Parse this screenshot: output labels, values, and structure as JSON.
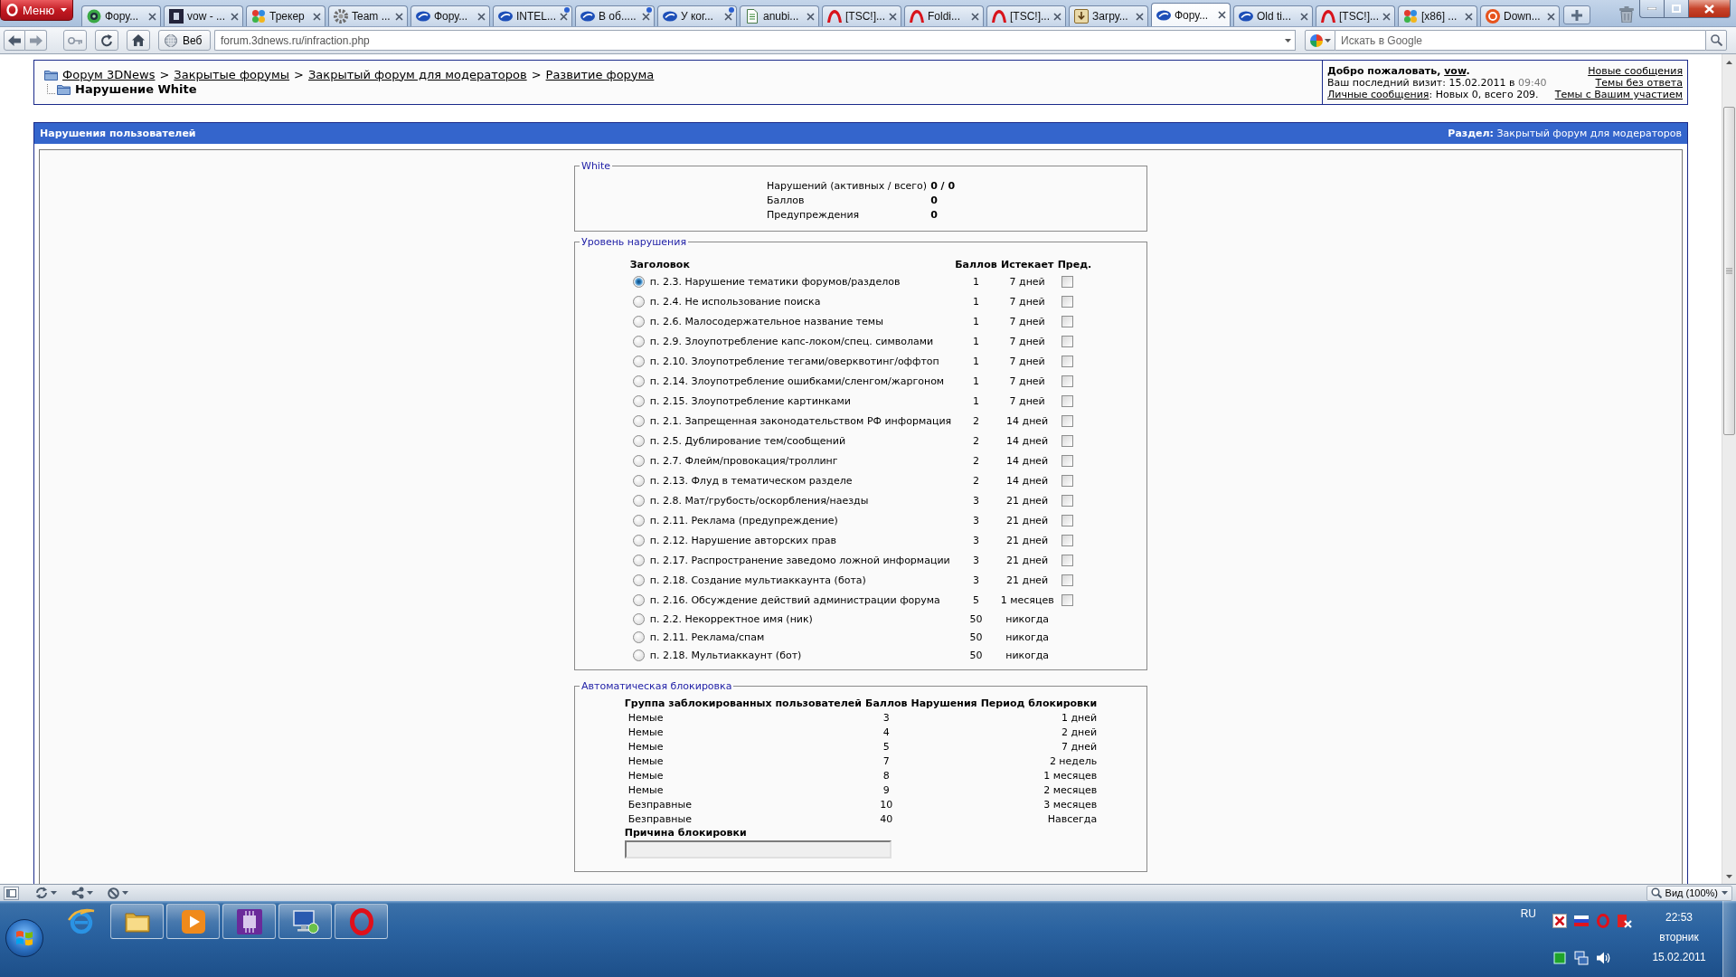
{
  "browser": {
    "menu_button": "Меню",
    "tabs": [
      {
        "title": "Фору...",
        "selected": false,
        "updated": false
      },
      {
        "title": "vow - ...",
        "selected": false,
        "updated": false
      },
      {
        "title": "Трекер",
        "selected": false,
        "updated": false
      },
      {
        "title": "Team ...",
        "selected": false,
        "updated": false
      },
      {
        "title": "Фору...",
        "selected": false,
        "updated": false
      },
      {
        "title": "INTEL...",
        "selected": false,
        "updated": true
      },
      {
        "title": "В об.....",
        "selected": false,
        "updated": true
      },
      {
        "title": "У ког...",
        "selected": false,
        "updated": true
      },
      {
        "title": "anubi...",
        "selected": false,
        "updated": false
      },
      {
        "title": "[TSC!]...",
        "selected": false,
        "updated": false
      },
      {
        "title": "Foldi...",
        "selected": false,
        "updated": false
      },
      {
        "title": "[TSC!]...",
        "selected": false,
        "updated": false
      },
      {
        "title": "Загру...",
        "selected": false,
        "updated": false
      },
      {
        "title": "Фору...",
        "selected": true,
        "updated": false
      },
      {
        "title": "Old ti...",
        "selected": false,
        "updated": false
      },
      {
        "title": "[TSC!]...",
        "selected": false,
        "updated": false
      },
      {
        "title": "[x86] ...",
        "selected": false,
        "updated": false
      },
      {
        "title": "Down...",
        "selected": false,
        "updated": false
      }
    ],
    "web_button": "Веб",
    "address": "forum.3dnews.ru/infraction.php",
    "search": {
      "placeholder": "Искать в Google"
    }
  },
  "header": {
    "breadcrumbs": [
      {
        "label": "Форум 3DNews"
      },
      {
        "separator": ">",
        "label": "Закрытые форумы"
      },
      {
        "separator": ">",
        "label": "Закрытый форум для модераторов"
      },
      {
        "separator": ">",
        "label": "Развитие форума"
      }
    ],
    "page_title": "Нарушение White",
    "welcome": {
      "greeting": "Добро пожаловать,",
      "username": "vow",
      "greeting_end": ".",
      "last_visit": "Ваш последний визит: 15.02.2011 в",
      "last_visit_time": "09:40",
      "messages_link": "Личные сообщения",
      "messages_info": ": Новых 0, всего 209."
    },
    "quick_links": [
      "Новые сообщения",
      "Темы без ответа",
      "Темы с Вашим участием"
    ]
  },
  "section_bar": {
    "title": "Нарушения пользователей",
    "forum": "**Раздел:** Закрытый форум для модераторов"
  },
  "user_summary": {
    "legend": "White",
    "rows": [
      {
        "label": "Нарушений (активных / всего)",
        "value": "0 / 0"
      },
      {
        "label": "Баллов",
        "value": "0"
      },
      {
        "label": "Предупреждения",
        "value": "0"
      }
    ]
  },
  "infraction_level": {
    "legend": "Уровень нарушения",
    "columns": [
      "Заголовок",
      "Баллов",
      "Истекает",
      "Пред."
    ],
    "rows": [
      {
        "kind": "expiring",
        "title": "п. 2.3. Нарушение тематики форумов/разделов",
        "points": "1",
        "expires": "7 дней",
        "selected": true,
        "warning": false
      },
      {
        "kind": "expiring",
        "title": "п. 2.4. Не использование поиска",
        "points": "1",
        "expires": "7 дней",
        "selected": false,
        "warning": false
      },
      {
        "kind": "expiring",
        "title": "п. 2.6. Малосодержательное название темы",
        "points": "1",
        "expires": "7 дней",
        "selected": false,
        "warning": false
      },
      {
        "kind": "expiring",
        "title": "п. 2.9. Злоупотребление капс-локом/спец. символами",
        "points": "1",
        "expires": "7 дней",
        "selected": false,
        "warning": false
      },
      {
        "kind": "expiring",
        "title": "п. 2.10. Злоупотребление тегами/оверквотинг/оффтоп",
        "points": "1",
        "expires": "7 дней",
        "selected": false,
        "warning": false
      },
      {
        "kind": "expiring",
        "title": "п. 2.14. Злоупотребление ошибками/сленгом/жаргоном",
        "points": "1",
        "expires": "7 дней",
        "selected": false,
        "warning": false
      },
      {
        "kind": "expiring",
        "title": "п. 2.15. Злоупотребление картинками",
        "points": "1",
        "expires": "7 дней",
        "selected": false,
        "warning": false
      },
      {
        "kind": "expiring",
        "title": "п. 2.1. Запрещенная законодательством РФ информация",
        "points": "2",
        "expires": "14 дней",
        "selected": false,
        "warning": false
      },
      {
        "kind": "expiring",
        "title": "п. 2.5. Дублирование тем/сообщений",
        "points": "2",
        "expires": "14 дней",
        "selected": false,
        "warning": false
      },
      {
        "kind": "expiring",
        "title": "п. 2.7. Флейм/провокация/троллинг",
        "points": "2",
        "expires": "14 дней",
        "selected": false,
        "warning": false
      },
      {
        "kind": "expiring",
        "title": "п. 2.13. Флуд в тематическом разделе",
        "points": "2",
        "expires": "14 дней",
        "selected": false,
        "warning": false
      },
      {
        "kind": "expiring",
        "title": "п. 2.8. Мат/грубость/оскорбления/наезды",
        "points": "3",
        "expires": "21 дней",
        "selected": false,
        "warning": false
      },
      {
        "kind": "expiring",
        "title": "п. 2.11. Реклама (предупреждение)",
        "points": "3",
        "expires": "21 дней",
        "selected": false,
        "warning": false
      },
      {
        "kind": "expiring",
        "title": "п. 2.12. Нарушение авторских прав",
        "points": "3",
        "expires": "21 дней",
        "selected": false,
        "warning": false
      },
      {
        "kind": "expiring",
        "title": "п. 2.17. Распространение заведомо ложной информации",
        "points": "3",
        "expires": "21 дней",
        "selected": false,
        "warning": false
      },
      {
        "kind": "expiring",
        "title": "п. 2.18. Создание мультиаккаунта (бота)",
        "points": "3",
        "expires": "21 дней",
        "selected": false,
        "warning": false
      },
      {
        "kind": "expiring",
        "title": "п. 2.16. Обсуждение действий администрации форума",
        "points": "5",
        "expires": "1 месяцев",
        "selected": false,
        "warning": false
      },
      {
        "kind": "permanent",
        "title": "п. 2.2. Некорректное имя (ник)",
        "points": "50",
        "expires": "никогда",
        "selected": false
      },
      {
        "kind": "permanent",
        "title": "п. 2.11. Реклама/спам",
        "points": "50",
        "expires": "никогда",
        "selected": false
      },
      {
        "kind": "permanent",
        "title": "п. 2.18. Мультиаккаунт (бот)",
        "points": "50",
        "expires": "никогда",
        "selected": false
      }
    ]
  },
  "auto_ban": {
    "legend": "Автоматическая блокировка",
    "columns": [
      "Группа заблокированных пользователей",
      "Баллов",
      "Нарушения",
      "Период блокировки"
    ],
    "rows": [
      {
        "group": "Немые",
        "points": "3",
        "period": "1 дней"
      },
      {
        "group": "Немые",
        "points": "4",
        "period": "2 дней"
      },
      {
        "group": "Немые",
        "points": "5",
        "period": "7 дней"
      },
      {
        "group": "Немые",
        "points": "7",
        "period": "2 недель"
      },
      {
        "group": "Немые",
        "points": "8",
        "period": "1 месяцев"
      },
      {
        "group": "Немые",
        "points": "9",
        "period": "2 месяцев"
      },
      {
        "group": "Безправные",
        "points": "10",
        "period": "3 месяцев"
      },
      {
        "group": "Безправные",
        "points": "40",
        "period": "Навсегда"
      }
    ],
    "reason": {
      "label": "Причина блокировки",
      "disabled": true
    }
  },
  "status_bar": {
    "zoom": "Вид (100%)"
  },
  "taskbar": {
    "apps": [
      {
        "running": false
      },
      {
        "running": true
      },
      {
        "running": true
      },
      {
        "running": true
      },
      {
        "running": true
      },
      {
        "running": true
      }
    ],
    "language": "RU",
    "clock": {
      "time": "22:53",
      "day": "вторник",
      "date": "15.02.2011"
    }
  }
}
